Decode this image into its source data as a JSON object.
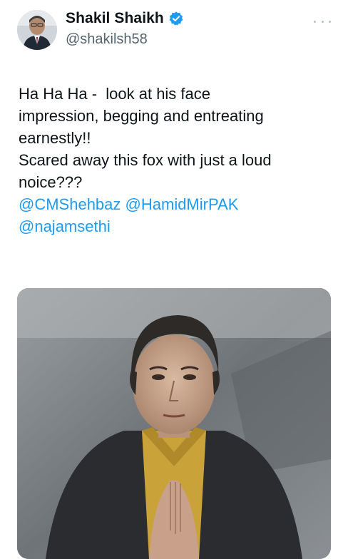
{
  "author": {
    "display_name": "Shakil Shaikh",
    "handle": "@shakilsh58",
    "verified": true,
    "verified_color": "#1d9bf0"
  },
  "tweet": {
    "lines": [
      "Ha Ha Ha -  look at his face",
      "impression, begging and entreating",
      "earnestly!!",
      "Scared away this fox with just a loud",
      "noice???"
    ],
    "mentions_line1": [
      "@CMShehbaz",
      "@HamidMirPAK"
    ],
    "mentions_line2": [
      "@najamsethi"
    ],
    "mention_color": "#1d9bf0"
  },
  "icons": {
    "verified": "verified-badge-icon",
    "more": "more-options-icon"
  }
}
